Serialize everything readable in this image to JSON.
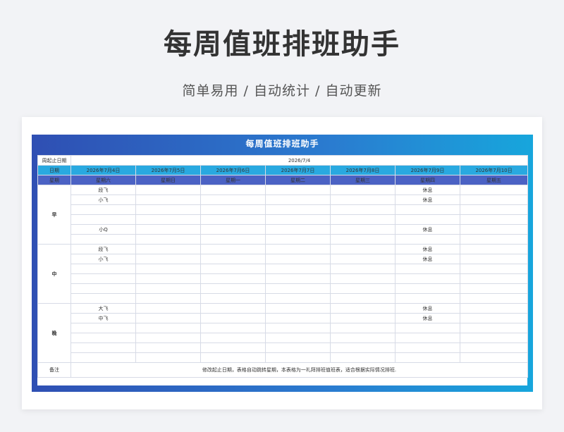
{
  "header": {
    "title": "每周值班排班助手",
    "subtitle": "简单易用 / 自动统计 / 自动更新"
  },
  "sheet": {
    "title": "每周值班排班助手",
    "start_label": "周起止日期",
    "start_value": "2026/7/4",
    "date_label": "日期",
    "week_label": "星期",
    "dates": [
      "2026年7月4日",
      "2026年7月5日",
      "2026年7月6日",
      "2026年7月7日",
      "2026年7月8日",
      "2026年7月9日",
      "2026年7月10日"
    ],
    "weekdays": [
      "星期六",
      "星期日",
      "星期一",
      "星期二",
      "星期三",
      "星期四",
      "星期五"
    ],
    "shifts": [
      {
        "name": "早",
        "rows": [
          [
            "段飞",
            "",
            "",
            "",
            "",
            "休息",
            ""
          ],
          [
            "小飞",
            "",
            "",
            "",
            "",
            "休息",
            ""
          ],
          [
            "",
            "",
            "",
            "",
            "",
            "",
            ""
          ],
          [
            "",
            "",
            "",
            "",
            "",
            "",
            ""
          ],
          [
            "小Q",
            "",
            "",
            "",
            "",
            "休息",
            ""
          ],
          [
            "",
            "",
            "",
            "",
            "",
            "",
            ""
          ]
        ]
      },
      {
        "name": "中",
        "rows": [
          [
            "段飞",
            "",
            "",
            "",
            "",
            "休息",
            ""
          ],
          [
            "小飞",
            "",
            "",
            "",
            "",
            "休息",
            ""
          ],
          [
            "",
            "",
            "",
            "",
            "",
            "",
            ""
          ],
          [
            "",
            "",
            "",
            "",
            "",
            "",
            ""
          ],
          [
            "",
            "",
            "",
            "",
            "",
            "",
            ""
          ],
          [
            "",
            "",
            "",
            "",
            "",
            "",
            ""
          ]
        ]
      },
      {
        "name": "晚",
        "rows": [
          [
            "大飞",
            "",
            "",
            "",
            "",
            "休息",
            ""
          ],
          [
            "中飞",
            "",
            "",
            "",
            "",
            "休息",
            ""
          ],
          [
            "",
            "",
            "",
            "",
            "",
            "",
            ""
          ],
          [
            "",
            "",
            "",
            "",
            "",
            "",
            ""
          ],
          [
            "",
            "",
            "",
            "",
            "",
            "",
            ""
          ],
          [
            "",
            "",
            "",
            "",
            "",
            "",
            ""
          ]
        ]
      }
    ],
    "note_label": "备注",
    "note_text": "修改起止日期，表格自动跳转星期，本表格为一礼拜排班值班表，适合根据实际情况排班."
  }
}
